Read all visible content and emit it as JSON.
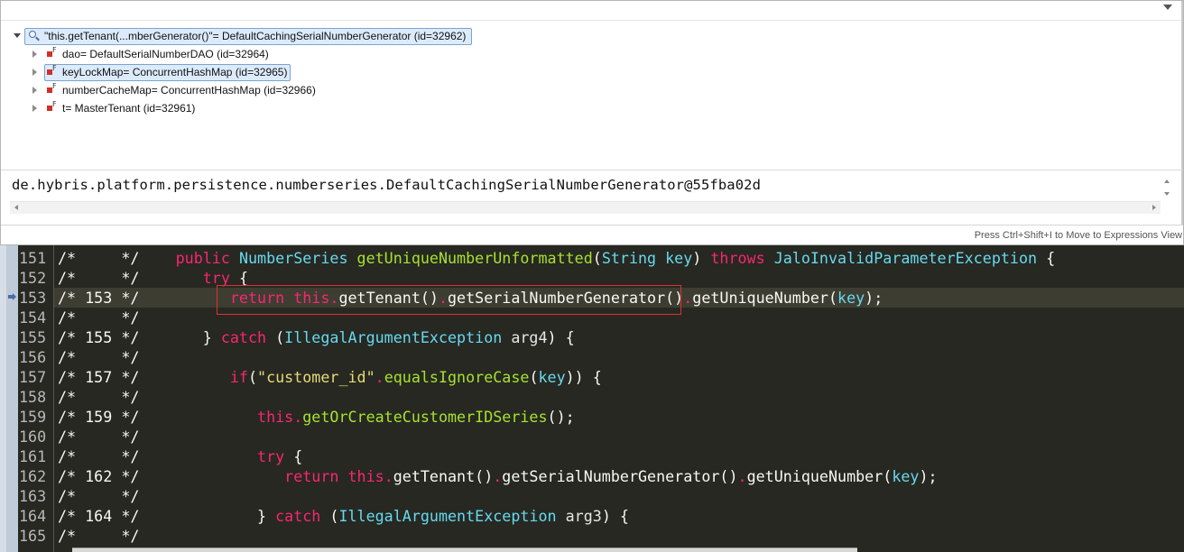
{
  "inspect_popup": {
    "root": {
      "label": "\"this.getTenant(...mberGenerator()\"= DefaultCachingSerialNumberGenerator  (id=32962)",
      "icon": "magnifier-icon"
    },
    "fields": [
      {
        "label": "dao= DefaultSerialNumberDAO  (id=32964)"
      },
      {
        "label": "keyLockMap= ConcurrentHashMap  (id=32965)"
      },
      {
        "label": "numberCacheMap= ConcurrentHashMap  (id=32966)"
      },
      {
        "label": "t= MasterTenant  (id=32961)"
      }
    ],
    "detail_value": "de.hybris.platform.persistence.numberseries.DefaultCachingSerialNumberGenerator@55fba02d",
    "status_hint": "Press Ctrl+Shift+I to Move to Expressions View"
  },
  "editor": {
    "lines": [
      {
        "num": "151",
        "marker": "/*     */"
      },
      {
        "num": "152",
        "marker": "/*     */"
      },
      {
        "num": "153",
        "marker": "/* 153 */"
      },
      {
        "num": "154",
        "marker": "/*     */"
      },
      {
        "num": "155",
        "marker": "/* 155 */"
      },
      {
        "num": "156",
        "marker": "/*     */"
      },
      {
        "num": "157",
        "marker": "/* 157 */"
      },
      {
        "num": "158",
        "marker": "/*     */"
      },
      {
        "num": "159",
        "marker": "/* 159 */"
      },
      {
        "num": "160",
        "marker": "/*     */"
      },
      {
        "num": "161",
        "marker": "/*     */"
      },
      {
        "num": "162",
        "marker": "/* 162 */"
      },
      {
        "num": "163",
        "marker": "/*     */"
      },
      {
        "num": "164",
        "marker": "/* 164 */"
      },
      {
        "num": "165",
        "marker": "/*     */"
      }
    ],
    "code": {
      "l151": {
        "kw_public": "public",
        "type": "NumberSeries",
        "method": "getUniqueNumberUnformatted",
        "open": "(",
        "ptype": "String",
        "param": "key",
        "close": ")",
        "kw_throws": "throws",
        "exc": "JaloInvalidParameterException",
        "brace": "{"
      },
      "l152": {
        "kw_try": "try",
        "brace": "{"
      },
      "l153": {
        "kw_return": "return",
        "kw_this": "this",
        "dot1": ".",
        "m1": "getTenant",
        "p1": "()",
        "dot2": ".",
        "m2": "getSerialNumberGenerator",
        "p2": "()",
        "dot3": ".",
        "m3": "getUniqueNumber",
        "open": "(",
        "arg": "key",
        "close": ");"
      },
      "l155": {
        "brace": "}",
        "kw_catch": "catch",
        "open": "(",
        "exc": "IllegalArgumentException",
        "var": "arg4",
        "close": ") {"
      },
      "l157": {
        "kw_if": "if",
        "open": "(",
        "str": "\"customer_id\"",
        "dot": ".",
        "m": "equalsIgnoreCase",
        "open2": "(",
        "arg": "key",
        "close": ")) {"
      },
      "l159": {
        "kw_this": "this",
        "dot": ".",
        "m": "getOrCreateCustomerIDSeries",
        "close": "();"
      },
      "l161": {
        "kw_try": "try",
        "brace": "{"
      },
      "l162": {
        "kw_return": "return",
        "kw_this": "this",
        "dot1": ".",
        "m1": "getTenant",
        "p1": "()",
        "dot2": ".",
        "m2": "getSerialNumberGenerator",
        "p2": "()",
        "dot3": ".",
        "m3": "getUniqueNumber",
        "open": "(",
        "arg": "key",
        "close": ");"
      },
      "l164": {
        "brace": "}",
        "kw_catch": "catch",
        "open": "(",
        "exc": "IllegalArgumentException",
        "var": "arg3",
        "close": ") {"
      }
    }
  },
  "colors": {
    "editor_bg": "#272822",
    "keyword": "#f92672",
    "type": "#66d9ef",
    "method": "#a6e22e",
    "param": "#fd971f",
    "string": "#e6db74",
    "highlight_box": "#e0302d",
    "selection": "#dcebfc"
  }
}
